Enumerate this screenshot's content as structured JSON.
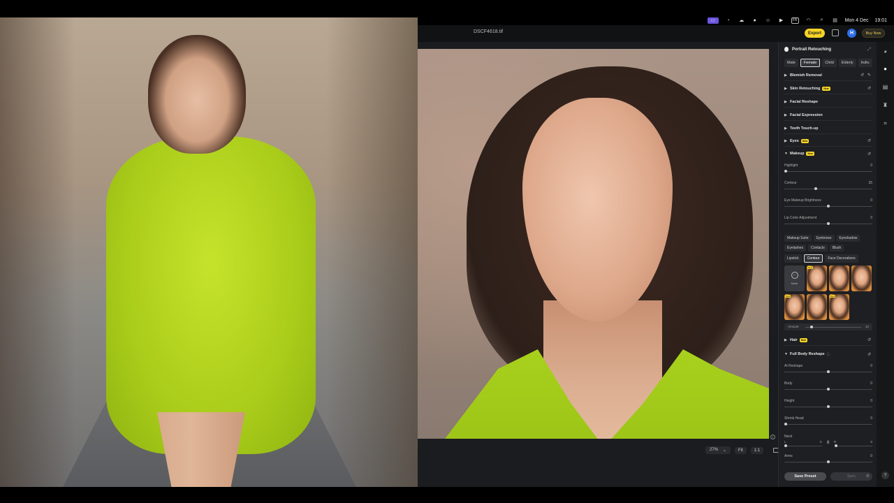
{
  "menubar": {
    "date": "Mon 4 Dec",
    "time": "19:01"
  },
  "titlebar": {
    "filename": "DSCF4618.tif",
    "export_label": "Export",
    "avatar_letter": "H",
    "buy_label": "Buy Now"
  },
  "canvas": {
    "zoom": "27%",
    "fit_label": "Fit",
    "one_to_one_label": "1:1"
  },
  "panel": {
    "title": "Portrait Retouching",
    "gender_tabs": [
      "Male",
      "Female",
      "Child",
      "Elderly",
      "Indiv."
    ],
    "active_gender": "Female",
    "sections": {
      "blemish": "Blemish Removal",
      "skin": "Skin Retouching",
      "reshape": "Facial Reshape",
      "expression": "Facial Expression",
      "teeth": "Teeth Touch-up",
      "eyes": "Eyes",
      "makeup": "Makeup",
      "hair": "Hair",
      "body": "Full Body Reshape"
    },
    "new_badge": "New",
    "makeup_sliders": [
      {
        "label": "Highlight",
        "value": "0",
        "level": 0.0
      },
      {
        "label": "Contour",
        "value": "35",
        "level": 0.35
      },
      {
        "label": "Eye Makeup Brightness",
        "value": "0",
        "level": 0.5
      },
      {
        "label": "Lip Color Adjustment",
        "value": "0",
        "level": 0.5
      }
    ],
    "makeup_chips_row1": [
      "Makeup Suite",
      "Eyebrows",
      "Eyeshadow"
    ],
    "makeup_chips_row2": [
      "Eyelashes",
      "Contacts",
      "Blush"
    ],
    "makeup_chips_row3": [
      "Lipstick",
      "Contour",
      "Face Decorations"
    ],
    "active_chip": "Contour",
    "none_label": "None",
    "amount": {
      "label": "Amount",
      "value": "12"
    },
    "body_sliders": [
      {
        "label": "AI Reshape",
        "value": "0",
        "level": 0.5
      },
      {
        "label": "Body",
        "value": "0",
        "level": 0.5
      },
      {
        "label": "Height",
        "value": "0",
        "level": 0.5
      },
      {
        "label": "Shrink Head",
        "value": "0",
        "level": 0.0
      }
    ],
    "neck": {
      "label": "Neck",
      "l": "L",
      "l_value": "0",
      "r": "R",
      "r_value": "0"
    },
    "arms": {
      "label": "Arms",
      "value": "0"
    },
    "save_preset": "Save Preset",
    "sync": "Sync"
  }
}
